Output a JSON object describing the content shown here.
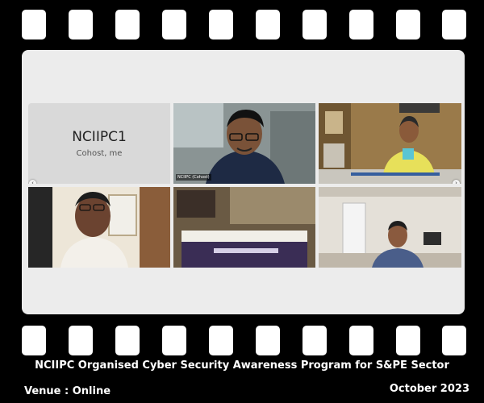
{
  "meeting": {
    "tiles": [
      {
        "name": "NCIIPC1",
        "role": "Cohost, me"
      },
      {
        "tag": "NCIIPC (Cohost)"
      },
      {
        "tag": ""
      },
      {
        "tag": ""
      },
      {
        "tag": ""
      },
      {
        "tag": ""
      }
    ],
    "prev_icon": "chevron-left-icon",
    "next_icon": "chevron-right-icon"
  },
  "footer": {
    "caption": "NCIIPC Organised Cyber Security Awareness Program for S&PE Sector",
    "venue": "Venue : Online",
    "date": "October 2023"
  },
  "colors": {
    "frame": "#000000",
    "holes": "#ffffff",
    "screen": "#ececec",
    "text": "#ffffff"
  }
}
